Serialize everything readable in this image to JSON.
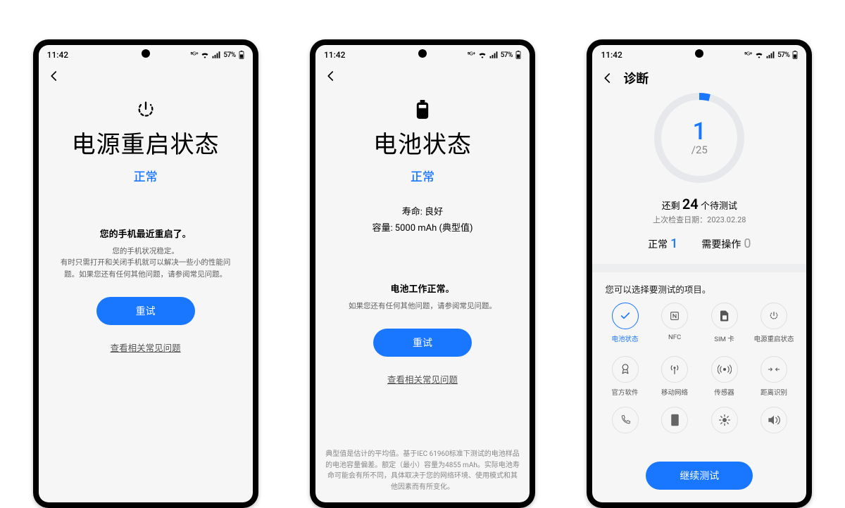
{
  "status_bar": {
    "time": "11:42",
    "battery": "57%"
  },
  "screen1": {
    "title": "电源重启状态",
    "status": "正常",
    "notice": "您的手机最近重启了。",
    "para1": "您的手机状况稳定。",
    "para2": "有时只需打开和关闭手机就可以解决一些小的性能问题。如果您还有任何其他问题，请参阅常见问题。",
    "retry": "重试",
    "faq": "查看相关常见问题"
  },
  "screen2": {
    "title": "电池状态",
    "status": "正常",
    "life": "寿命: 良好",
    "capacity": "容量: 5000 mAh (典型值)",
    "working": "电池工作正常。",
    "hint": "如果您还有任何其他问题，请参阅常见问题。",
    "retry": "重试",
    "faq": "查看相关常见问题",
    "fine": "典型值是估计的平均值。基于IEC 61960标准下测试的电池样品的电池容量偏差。额定（最小）容量为4855 mAh。实际电池寿命可能会有所不同，具体取决于您的网络环境、使用模式和其他因素而有所变化。"
  },
  "screen3": {
    "page": "诊断",
    "progress_done": 1,
    "progress_total": "/25",
    "remain_pre": "还剩 ",
    "remain_num": "24",
    "remain_post": " 个待测试",
    "last_check": "上次检查日期：2023.02.28",
    "ok_label": "正常",
    "ok_num": "1",
    "need_label": "需要操作",
    "need_num": "0",
    "section_hint": "您可以选择要测试的项目。",
    "items": {
      "i0": "电池状态",
      "i1": "NFC",
      "i2": "SIM 卡",
      "i3": "电源重启状态",
      "i4": "官方软件",
      "i5": "移动网络",
      "i6": "传感器",
      "i7": "距离识别"
    },
    "continue": "继续测试"
  }
}
